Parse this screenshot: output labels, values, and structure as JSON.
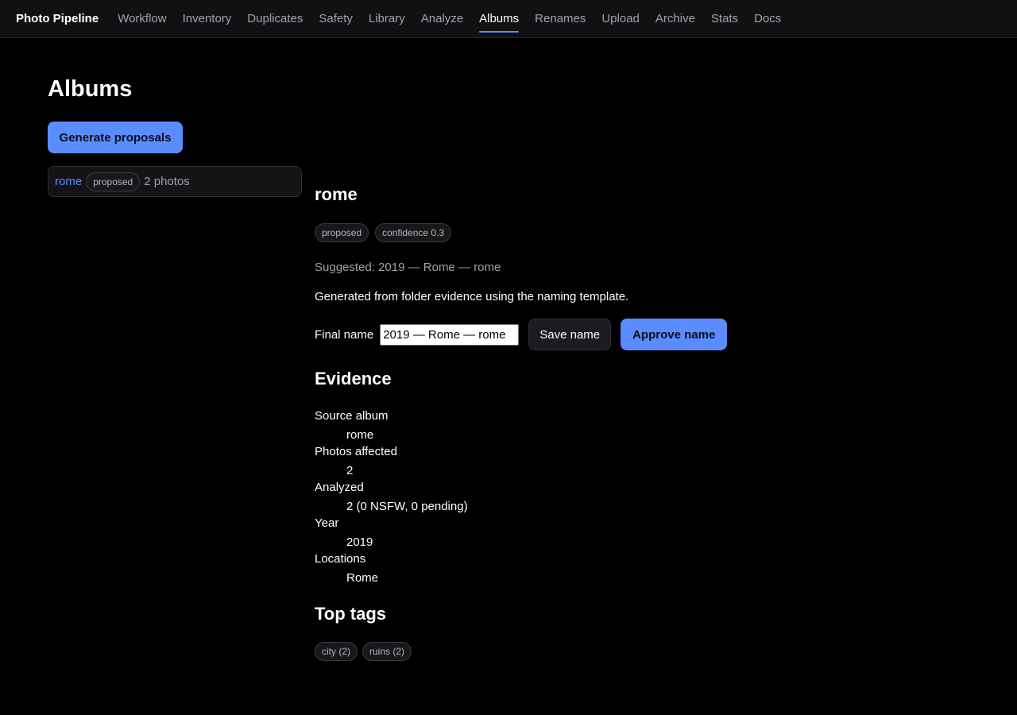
{
  "app": {
    "brand": "Photo Pipeline",
    "nav": [
      {
        "label": "Workflow"
      },
      {
        "label": "Inventory"
      },
      {
        "label": "Duplicates"
      },
      {
        "label": "Safety"
      },
      {
        "label": "Library"
      },
      {
        "label": "Analyze"
      },
      {
        "label": "Albums",
        "active": true
      },
      {
        "label": "Renames"
      },
      {
        "label": "Upload"
      },
      {
        "label": "Archive"
      },
      {
        "label": "Stats"
      },
      {
        "label": "Docs"
      }
    ],
    "accent_color": "#5b8cff"
  },
  "page": {
    "title": "Albums",
    "generate_button": "Generate proposals"
  },
  "album_list": [
    {
      "name": "rome",
      "status": "proposed",
      "count": "2 photos"
    }
  ],
  "detail": {
    "title": "rome",
    "status_badge": "proposed",
    "confidence_badge": "confidence 0.3",
    "suggested": "Suggested: 2019 — Rome — rome",
    "generated_note": "Generated from folder evidence using the naming template.",
    "final_name_label": "Final name",
    "final_name_value": "2019 — Rome — rome",
    "save_button": "Save name",
    "approve_button": "Approve name",
    "evidence_title": "Evidence",
    "evidence": [
      {
        "term": "Source album",
        "value": "rome"
      },
      {
        "term": "Photos affected",
        "value": "2"
      },
      {
        "term": "Analyzed",
        "value": "2 (0 NSFW, 0 pending)"
      },
      {
        "term": "Year",
        "value": "2019"
      },
      {
        "term": "Locations",
        "value": "Rome"
      }
    ],
    "tags_title": "Top tags",
    "tags": [
      "city (2)",
      "ruins (2)"
    ]
  }
}
